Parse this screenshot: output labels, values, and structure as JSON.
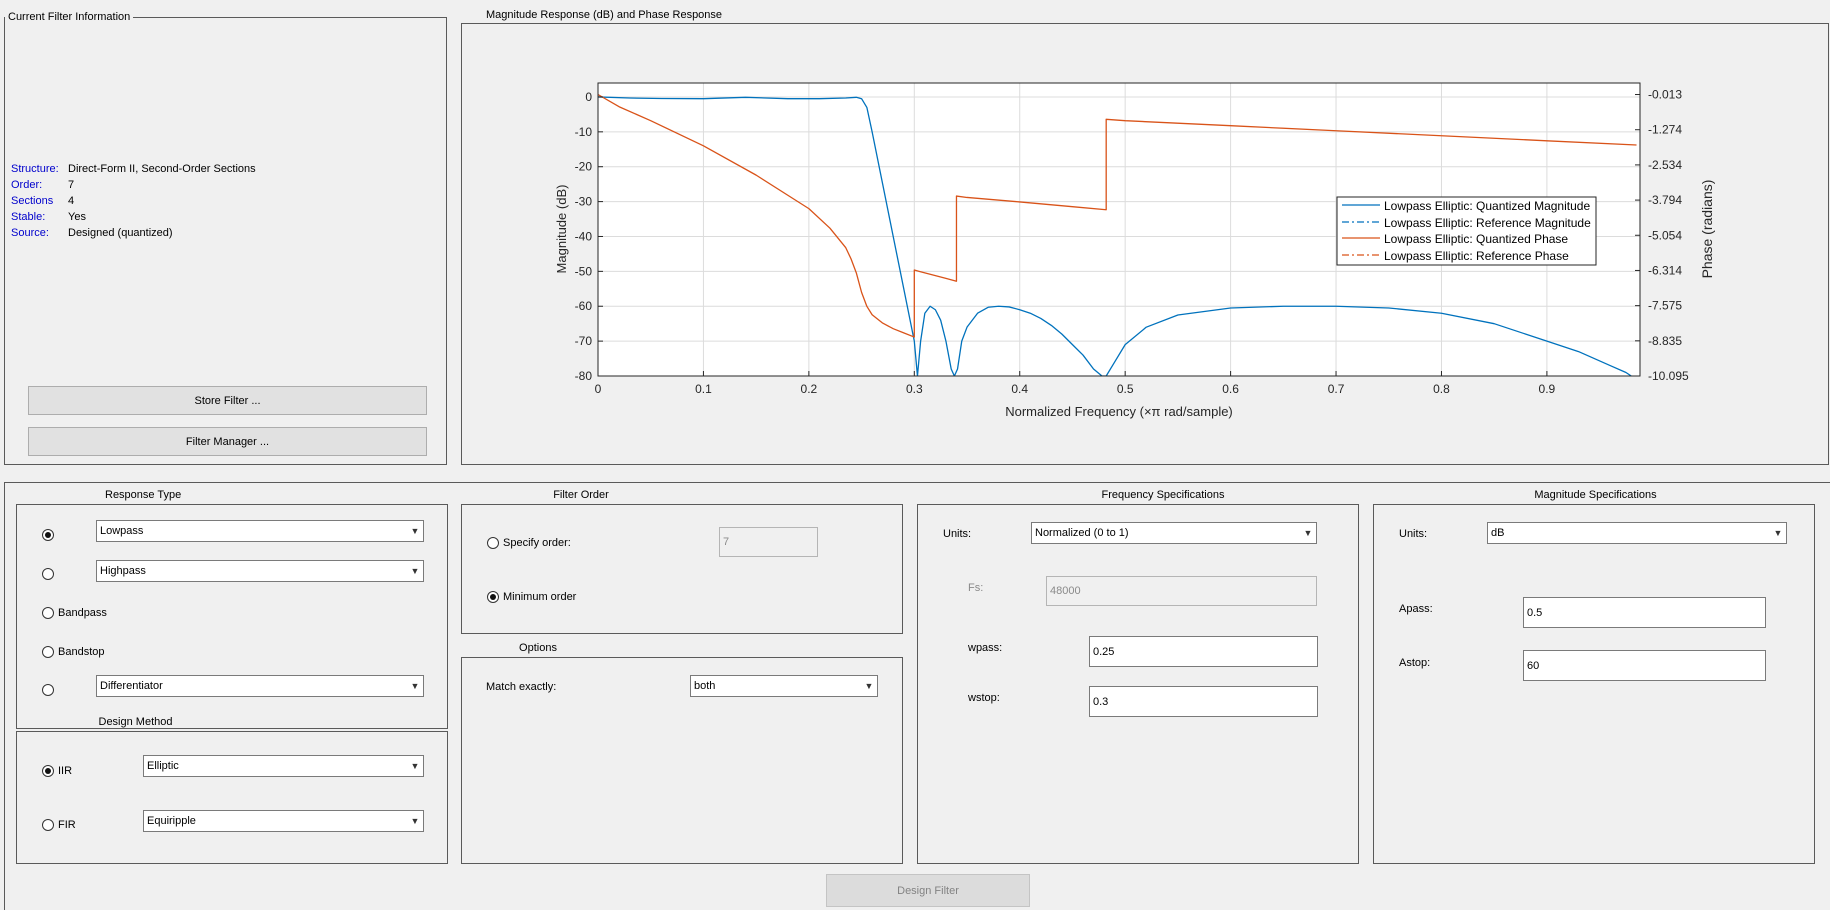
{
  "info_panel": {
    "title": "Current Filter Information",
    "rows": [
      {
        "key": "Structure:",
        "value": "Direct-Form II, Second-Order Sections"
      },
      {
        "key": "Order:",
        "value": "7"
      },
      {
        "key": "Sections",
        "value": "4"
      },
      {
        "key": "Stable:",
        "value": "Yes"
      },
      {
        "key": "Source:",
        "value": "Designed (quantized)"
      }
    ],
    "store_filter_label": "Store Filter ...",
    "filter_manager_label": "Filter Manager ..."
  },
  "plot_panel": {
    "title": "Magnitude Response (dB) and Phase Response"
  },
  "chart_data": {
    "type": "line",
    "title": "",
    "xlabel": "Normalized Frequency (×π rad/sample)",
    "ylabel": "Magnitude (dB)",
    "y2label": "Phase (radians)",
    "xlim": [
      0,
      0.9883
    ],
    "ylim": [
      -80,
      4
    ],
    "y2lim": [
      -10.095,
      0.4
    ],
    "grid": true,
    "legend_position": "right",
    "x_ticks": [
      0,
      0.1,
      0.2,
      0.3,
      0.4,
      0.5,
      0.6,
      0.7,
      0.8,
      0.9
    ],
    "x_tick_labels": [
      "0",
      "0.1",
      "0.2",
      "0.3",
      "0.4",
      "0.5",
      "0.6",
      "0.7",
      "0.8",
      "0.9"
    ],
    "y_ticks": [
      0,
      -10,
      -20,
      -30,
      -40,
      -50,
      -60,
      -70,
      -80
    ],
    "y_tick_labels": [
      "0",
      "-10",
      "-20",
      "-30",
      "-40",
      "-50",
      "-60",
      "-70",
      "-80"
    ],
    "y2_ticks": [
      -0.013,
      -1.274,
      -2.534,
      -3.794,
      -5.054,
      -6.314,
      -7.575,
      -8.835,
      -10.095
    ],
    "y2_tick_labels": [
      "-0.013",
      "-1.274",
      "-2.534",
      "-3.794",
      "-5.054",
      "-6.314",
      "-7.575",
      "-8.835",
      "-10.095"
    ],
    "series": [
      {
        "name": "Lowpass Elliptic: Quantized Magnitude",
        "color": "#0072bd",
        "dash": "solid",
        "axis": "left",
        "x": [
          0,
          0.03,
          0.06,
          0.1,
          0.14,
          0.18,
          0.21,
          0.235,
          0.245,
          0.25,
          0.255,
          0.26,
          0.27,
          0.28,
          0.29,
          0.3,
          0.303,
          0.306,
          0.31,
          0.315,
          0.32,
          0.325,
          0.33,
          0.335,
          0.338,
          0.341,
          0.345,
          0.35,
          0.36,
          0.37,
          0.38,
          0.39,
          0.4,
          0.41,
          0.42,
          0.43,
          0.44,
          0.45,
          0.46,
          0.47,
          0.478,
          0.482,
          0.49,
          0.5,
          0.52,
          0.55,
          0.6,
          0.65,
          0.7,
          0.75,
          0.8,
          0.85,
          0.9,
          0.93,
          0.96,
          0.975,
          0.98
        ],
        "y": [
          0,
          -0.3,
          -0.45,
          -0.5,
          -0.1,
          -0.5,
          -0.5,
          -0.3,
          -0.1,
          -0.5,
          -3,
          -10,
          -25,
          -40,
          -55,
          -70,
          -80,
          -70,
          -62,
          -60,
          -61,
          -64,
          -70,
          -78,
          -80,
          -78,
          -70,
          -66,
          -62,
          -60.3,
          -60,
          -60.2,
          -61,
          -62,
          -63.5,
          -65.5,
          -68,
          -71,
          -74,
          -78,
          -80,
          -80,
          -76,
          -71,
          -66,
          -62.5,
          -60.5,
          -60,
          -60,
          -60.5,
          -62,
          -65,
          -70,
          -73,
          -77,
          -79,
          -80
        ]
      },
      {
        "name": "Lowpass Elliptic: Reference Magnitude",
        "color": "#0072bd",
        "dash": "dashdot",
        "axis": "left",
        "x": [],
        "y": []
      },
      {
        "name": "Lowpass Elliptic: Quantized Phase",
        "color": "#d95319",
        "dash": "solid",
        "axis": "right",
        "x": [
          0,
          0.02,
          0.05,
          0.1,
          0.15,
          0.2,
          0.22,
          0.235,
          0.24,
          0.245,
          0.25,
          0.255,
          0.26,
          0.27,
          0.28,
          0.29,
          0.3,
          0.3,
          0.305,
          0.31,
          0.32,
          0.33,
          0.34,
          0.34,
          0.35,
          0.4,
          0.45,
          0.482,
          0.482,
          0.5,
          0.6,
          0.7,
          0.8,
          0.9,
          0.985
        ],
        "y": [
          -0.013,
          -0.45,
          -0.95,
          -1.85,
          -2.9,
          -4.1,
          -4.8,
          -5.5,
          -5.9,
          -6.4,
          -7.1,
          -7.6,
          -7.9,
          -8.2,
          -8.4,
          -8.55,
          -8.7,
          -6.3,
          -6.35,
          -6.4,
          -6.5,
          -6.6,
          -6.7,
          -3.65,
          -3.7,
          -3.86,
          -4.03,
          -4.14,
          -0.9,
          -0.95,
          -1.13,
          -1.31,
          -1.49,
          -1.67,
          -1.82
        ]
      },
      {
        "name": "Lowpass Elliptic: Reference Phase",
        "color": "#d95319",
        "dash": "dashdot",
        "axis": "right",
        "x": [],
        "y": []
      }
    ]
  },
  "response_type": {
    "title": "Response Type",
    "lowpass": "Lowpass",
    "highpass": "Highpass",
    "bandpass": "Bandpass",
    "bandstop": "Bandstop",
    "differentiator": "Differentiator",
    "selected": "Lowpass"
  },
  "design_method": {
    "title": "Design Method",
    "iir_label": "IIR",
    "iir_value": "Elliptic",
    "fir_label": "FIR",
    "fir_value": "Equiripple",
    "selected": "IIR"
  },
  "filter_order": {
    "title": "Filter Order",
    "specify_label": "Specify order:",
    "specify_value": "7",
    "minimum_label": "Minimum order",
    "selected": "Minimum order"
  },
  "options": {
    "title": "Options",
    "match_label": "Match exactly:",
    "match_value": "both"
  },
  "freq_spec": {
    "title": "Frequency Specifications",
    "units_label": "Units:",
    "units_value": "Normalized (0 to 1)",
    "fs_label": "Fs:",
    "fs_value": "48000",
    "wpass_label": "wpass:",
    "wpass_value": "0.25",
    "wstop_label": "wstop:",
    "wstop_value": "0.3"
  },
  "mag_spec": {
    "title": "Magnitude Specifications",
    "units_label": "Units:",
    "units_value": "dB",
    "apass_label": "Apass:",
    "apass_value": "0.5",
    "astop_label": "Astop:",
    "astop_value": "60"
  },
  "design_button_label": "Design Filter"
}
